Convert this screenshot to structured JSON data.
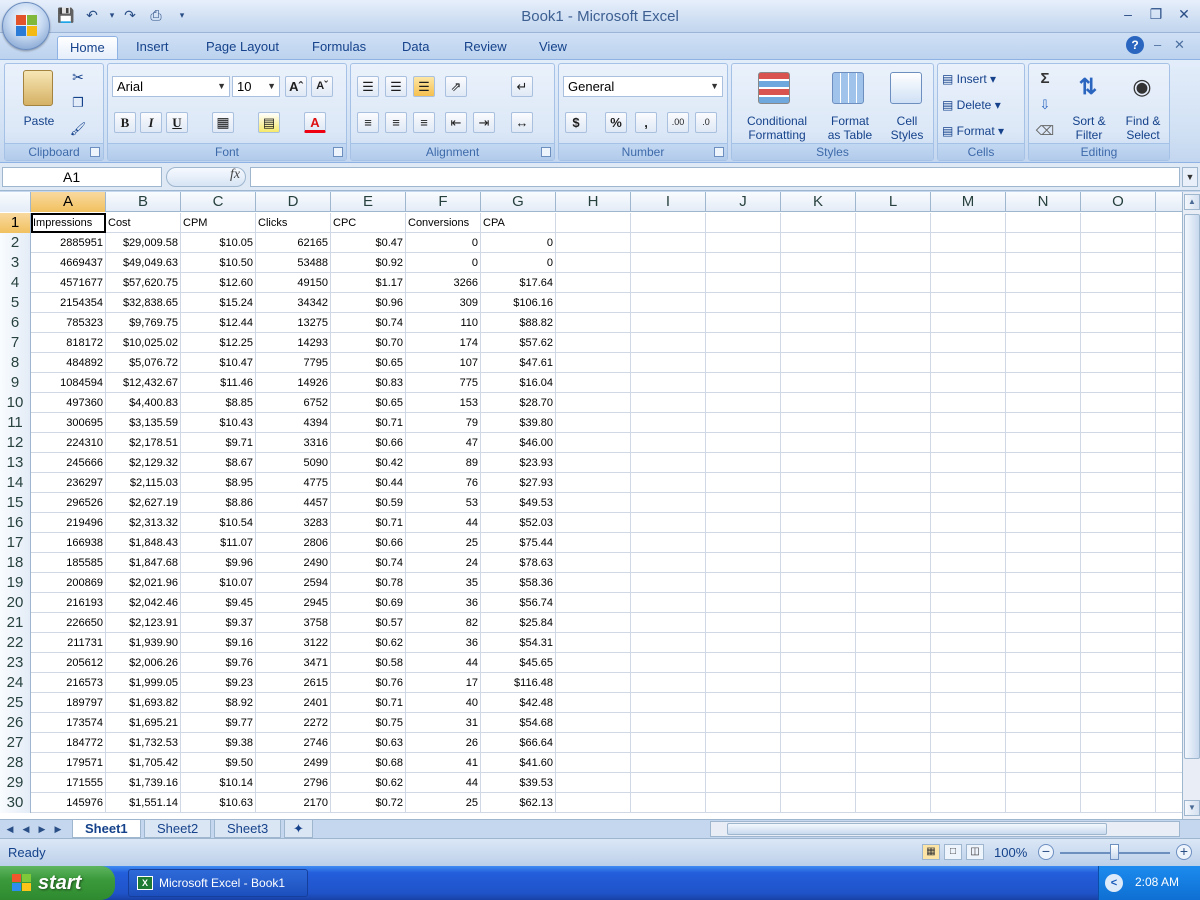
{
  "window": {
    "title": "Book1 - Microsoft Excel"
  },
  "ribbon": {
    "tabs": [
      "Home",
      "Insert",
      "Page Layout",
      "Formulas",
      "Data",
      "Review",
      "View"
    ],
    "active_tab": "Home",
    "groups": {
      "clipboard": {
        "label": "Clipboard",
        "paste": "Paste"
      },
      "font": {
        "label": "Font",
        "font_name": "Arial",
        "font_size": "10",
        "bold": "B",
        "italic": "I",
        "underline": "U"
      },
      "alignment": {
        "label": "Alignment"
      },
      "number": {
        "label": "Number",
        "format": "General",
        "currency": "$",
        "percent": "%",
        "comma": ","
      },
      "styles": {
        "label": "Styles",
        "conditional": "Conditional",
        "conditional2": "Formatting",
        "format_table": "Format",
        "format_table2": "as Table",
        "cell_styles": "Cell",
        "cell_styles2": "Styles"
      },
      "cells": {
        "label": "Cells",
        "insert": "Insert",
        "delete": "Delete",
        "format": "Format"
      },
      "editing": {
        "label": "Editing",
        "sort": "Sort &",
        "sort2": "Filter",
        "find": "Find &",
        "find2": "Select"
      }
    }
  },
  "formula_bar": {
    "name_box": "A1",
    "fx": "fx",
    "formula": ""
  },
  "grid": {
    "columns": [
      "A",
      "B",
      "C",
      "D",
      "E",
      "F",
      "G",
      "H",
      "I",
      "J",
      "K",
      "L",
      "M",
      "N",
      "O"
    ],
    "row_numbers": [
      "1",
      "2",
      "3",
      "4",
      "5",
      "6",
      "7",
      "8",
      "9",
      "10",
      "11",
      "12",
      "13",
      "14",
      "15",
      "16",
      "17",
      "18",
      "19",
      "20",
      "21",
      "22",
      "23",
      "24",
      "25",
      "26",
      "27",
      "28",
      "29",
      "30"
    ],
    "headers": [
      "Impressions",
      "Cost",
      "CPM",
      "Clicks",
      "CPC",
      "Conversions",
      "CPA"
    ],
    "rows": [
      [
        "2885951",
        "$29,009.58",
        "$10.05",
        "62165",
        "$0.47",
        "0",
        "0"
      ],
      [
        "4669437",
        "$49,049.63",
        "$10.50",
        "53488",
        "$0.92",
        "0",
        "0"
      ],
      [
        "4571677",
        "$57,620.75",
        "$12.60",
        "49150",
        "$1.17",
        "3266",
        "$17.64"
      ],
      [
        "2154354",
        "$32,838.65",
        "$15.24",
        "34342",
        "$0.96",
        "309",
        "$106.16"
      ],
      [
        "785323",
        "$9,769.75",
        "$12.44",
        "13275",
        "$0.74",
        "110",
        "$88.82"
      ],
      [
        "818172",
        "$10,025.02",
        "$12.25",
        "14293",
        "$0.70",
        "174",
        "$57.62"
      ],
      [
        "484892",
        "$5,076.72",
        "$10.47",
        "7795",
        "$0.65",
        "107",
        "$47.61"
      ],
      [
        "1084594",
        "$12,432.67",
        "$11.46",
        "14926",
        "$0.83",
        "775",
        "$16.04"
      ],
      [
        "497360",
        "$4,400.83",
        "$8.85",
        "6752",
        "$0.65",
        "153",
        "$28.70"
      ],
      [
        "300695",
        "$3,135.59",
        "$10.43",
        "4394",
        "$0.71",
        "79",
        "$39.80"
      ],
      [
        "224310",
        "$2,178.51",
        "$9.71",
        "3316",
        "$0.66",
        "47",
        "$46.00"
      ],
      [
        "245666",
        "$2,129.32",
        "$8.67",
        "5090",
        "$0.42",
        "89",
        "$23.93"
      ],
      [
        "236297",
        "$2,115.03",
        "$8.95",
        "4775",
        "$0.44",
        "76",
        "$27.93"
      ],
      [
        "296526",
        "$2,627.19",
        "$8.86",
        "4457",
        "$0.59",
        "53",
        "$49.53"
      ],
      [
        "219496",
        "$2,313.32",
        "$10.54",
        "3283",
        "$0.71",
        "44",
        "$52.03"
      ],
      [
        "166938",
        "$1,848.43",
        "$11.07",
        "2806",
        "$0.66",
        "25",
        "$75.44"
      ],
      [
        "185585",
        "$1,847.68",
        "$9.96",
        "2490",
        "$0.74",
        "24",
        "$78.63"
      ],
      [
        "200869",
        "$2,021.96",
        "$10.07",
        "2594",
        "$0.78",
        "35",
        "$58.36"
      ],
      [
        "216193",
        "$2,042.46",
        "$9.45",
        "2945",
        "$0.69",
        "36",
        "$56.74"
      ],
      [
        "226650",
        "$2,123.91",
        "$9.37",
        "3758",
        "$0.57",
        "82",
        "$25.84"
      ],
      [
        "211731",
        "$1,939.90",
        "$9.16",
        "3122",
        "$0.62",
        "36",
        "$54.31"
      ],
      [
        "205612",
        "$2,006.26",
        "$9.76",
        "3471",
        "$0.58",
        "44",
        "$45.65"
      ],
      [
        "216573",
        "$1,999.05",
        "$9.23",
        "2615",
        "$0.76",
        "17",
        "$116.48"
      ],
      [
        "189797",
        "$1,693.82",
        "$8.92",
        "2401",
        "$0.71",
        "40",
        "$42.48"
      ],
      [
        "173574",
        "$1,695.21",
        "$9.77",
        "2272",
        "$0.75",
        "31",
        "$54.68"
      ],
      [
        "184772",
        "$1,732.53",
        "$9.38",
        "2746",
        "$0.63",
        "26",
        "$66.64"
      ],
      [
        "179571",
        "$1,705.42",
        "$9.50",
        "2499",
        "$0.68",
        "41",
        "$41.60"
      ],
      [
        "171555",
        "$1,739.16",
        "$10.14",
        "2796",
        "$0.62",
        "44",
        "$39.53"
      ],
      [
        "145976",
        "$1,551.14",
        "$10.63",
        "2170",
        "$0.72",
        "25",
        "$62.13"
      ]
    ]
  },
  "sheets": [
    "Sheet1",
    "Sheet2",
    "Sheet3"
  ],
  "active_sheet": "Sheet1",
  "status": {
    "text": "Ready",
    "zoom": "100%"
  },
  "taskbar": {
    "start": "start",
    "task": "Microsoft Excel - Book1",
    "clock": "2:08 AM"
  }
}
